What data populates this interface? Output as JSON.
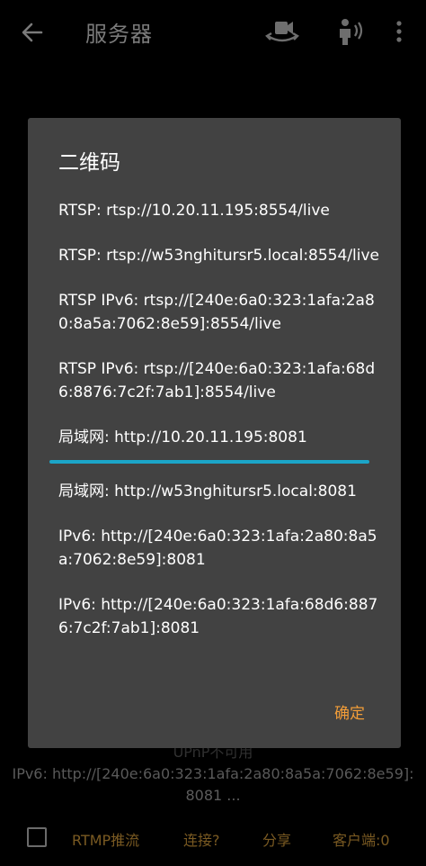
{
  "appbar": {
    "title": "服务器"
  },
  "background": {
    "upnp_text": "UPnP不可用",
    "ipv6_line1": "IPv6: http://[240e:6a0:323:1afa:2a80:8a5a:7062:8e59]:",
    "ipv6_line2": "8081 ..."
  },
  "bottombar": {
    "rtmp": "RTMP推流",
    "connect": "连接?",
    "share": "分享",
    "clients": "客户端:0"
  },
  "dialog": {
    "title": "二维码",
    "entries": [
      "RTSP: rtsp://10.20.11.195:8554/live",
      "RTSP: rtsp://w53nghitursr5.local:8554/live",
      "RTSP IPv6: rtsp://[240e:6a0:323:1afa:2a80:8a5a:7062:8e59]:8554/live",
      "RTSP IPv6: rtsp://[240e:6a0:323:1afa:68d6:8876:7c2f:7ab1]:8554/live",
      "局域网: http://10.20.11.195:8081",
      "局域网: http://w53nghitursr5.local:8081",
      "IPv6: http://[240e:6a0:323:1afa:2a80:8a5a:7062:8e59]:8081",
      "IPv6: http://[240e:6a0:323:1afa:68d6:8876:7c2f:7ab1]:8081"
    ],
    "ok_label": "确定"
  },
  "colors": {
    "dialog_bg": "#424242",
    "accent": "#f29d38",
    "selection": "#1ba5c8"
  }
}
